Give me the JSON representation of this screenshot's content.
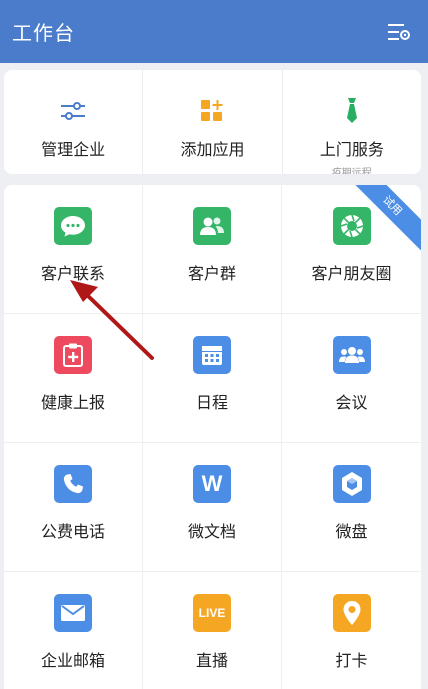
{
  "header": {
    "title": "工作台",
    "settings_icon": "list-settings-icon"
  },
  "top_actions": [
    {
      "label": "管理企业",
      "icon": "sliders-icon",
      "color": "#4a7ccb"
    },
    {
      "label": "添加应用",
      "icon": "add-apps-icon",
      "color": "#f5a623"
    },
    {
      "label": "上门服务",
      "sublabel": "疫期远程",
      "icon": "tie-icon",
      "color": "#27ae60"
    }
  ],
  "apps": [
    {
      "label": "客户联系",
      "icon": "chat-bubble-icon",
      "color": "#35b567"
    },
    {
      "label": "客户群",
      "icon": "customer-group-icon",
      "color": "#35b567"
    },
    {
      "label": "客户朋友圈",
      "icon": "aperture-icon",
      "color": "#35b567",
      "badge": "试用"
    },
    {
      "label": "健康上报",
      "icon": "health-report-icon",
      "color": "#ee4a5f"
    },
    {
      "label": "日程",
      "icon": "calendar-icon",
      "color": "#4c8ee6"
    },
    {
      "label": "会议",
      "icon": "meeting-icon",
      "color": "#4c8ee6"
    },
    {
      "label": "公费电话",
      "icon": "phone-icon",
      "color": "#4c8ee6"
    },
    {
      "label": "微文档",
      "icon": "doc-w-icon",
      "color": "#4c8ee6",
      "glyph": "W"
    },
    {
      "label": "微盘",
      "icon": "drive-icon",
      "color": "#4c8ee6"
    },
    {
      "label": "企业邮箱",
      "icon": "mail-icon",
      "color": "#4c8ee6"
    },
    {
      "label": "直播",
      "icon": "live-icon",
      "color": "#f5a623",
      "glyph": "LIVE"
    },
    {
      "label": "打卡",
      "icon": "location-pin-icon",
      "color": "#f5a623"
    }
  ],
  "annotation": {
    "arrow_color": "#b01818"
  }
}
